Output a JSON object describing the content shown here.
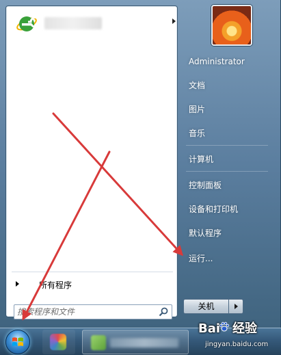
{
  "start_menu": {
    "all_programs_label": "所有程序",
    "search": {
      "placeholder": "搜索程序和文件",
      "value": ""
    },
    "right_items": [
      {
        "label": "Administrator"
      },
      {
        "label": "文档"
      },
      {
        "label": "图片"
      },
      {
        "label": "音乐"
      },
      {
        "label": "计算机"
      },
      {
        "label": "控制面板"
      },
      {
        "label": "设备和打印机"
      },
      {
        "label": "默认程序"
      },
      {
        "label": "运行..."
      }
    ],
    "shutdown_label": "关机"
  },
  "watermark": {
    "logo_text_a": "Bai",
    "logo_text_b": "经验",
    "site": "jingyan.baidu.com"
  },
  "colors": {
    "annotation_arrow": "#d83a3a",
    "menu_text": "#ffffff"
  },
  "icons": {
    "pinned": "internet-explorer-icon",
    "search": "magnifier-icon",
    "start": "windows-flag-icon"
  }
}
